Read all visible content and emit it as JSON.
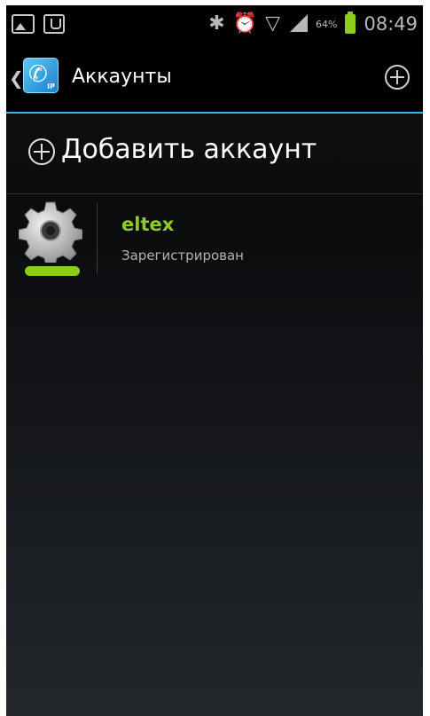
{
  "status_bar": {
    "icons": [
      "picture-icon",
      "usb-icon",
      "bluetooth-icon",
      "alarm-icon",
      "wifi-icon",
      "signal-icon",
      "battery-icon"
    ],
    "battery_percent": "64%",
    "time": "08:49"
  },
  "action_bar": {
    "title": "Аккаунты",
    "app_icon_badge": "IP",
    "accent_color": "#33b5e5"
  },
  "add_account": {
    "label": "Добавить аккаунт"
  },
  "accounts": [
    {
      "name": "eltex",
      "status": "Зарегистрирован",
      "status_color": "#8ccc1a"
    }
  ]
}
